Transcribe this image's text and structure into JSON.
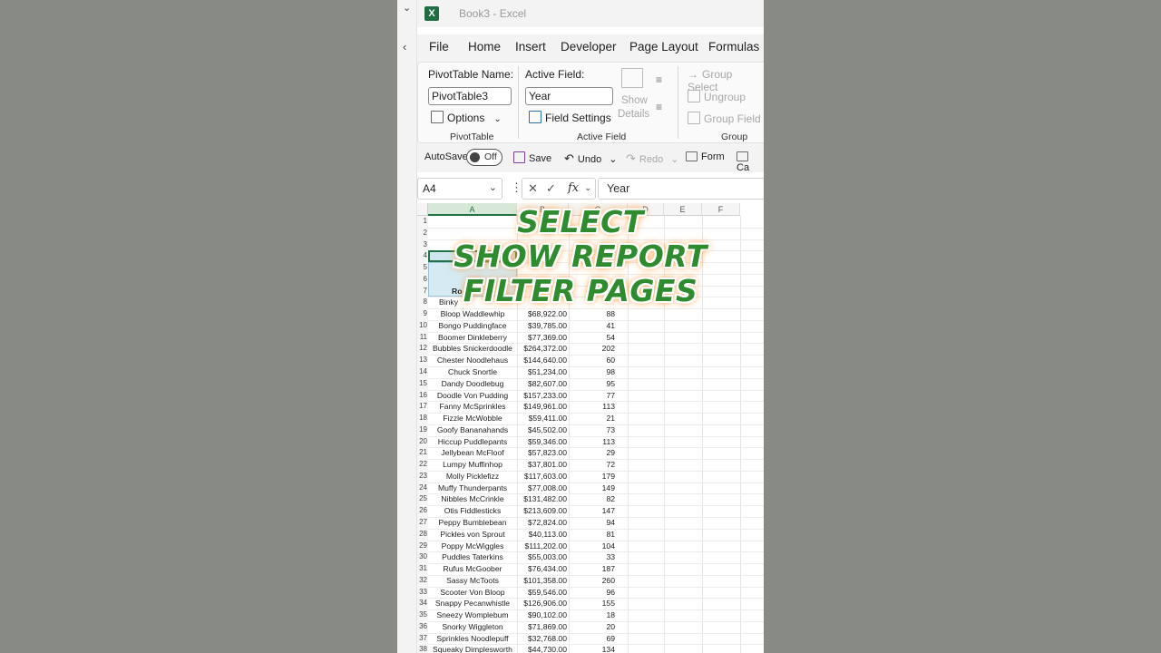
{
  "window": {
    "title": "Book3 - Excel",
    "app_icon": "excel-logo-icon"
  },
  "menu_tabs": [
    "File",
    "Home",
    "Insert",
    "Developer",
    "Page Layout",
    "Formulas"
  ],
  "ribbon": {
    "pivottable": {
      "name_label": "PivotTable Name:",
      "name_value": "PivotTable3",
      "options_label": "Options",
      "group_label": "PivotTable"
    },
    "active_field": {
      "label": "Active Field:",
      "value": "Year",
      "field_settings_label": "Field Settings",
      "show_details_line1": "Show",
      "show_details_line2": "Details",
      "group_label": "Active Field"
    },
    "group": {
      "group_selection_label": "Group Select",
      "ungroup_label": "Ungroup",
      "group_field_label": "Group Field",
      "group_label": "Group"
    }
  },
  "qat": {
    "autosave_label": "AutoSave",
    "autosave_state": "Off",
    "save_label": "Save",
    "undo_label": "Undo",
    "redo_label": "Redo",
    "form_label": "Form",
    "camera_label": "Ca"
  },
  "formula_bar": {
    "name_box": "A4",
    "fx": "fx",
    "value": "Year"
  },
  "columns": [
    "A",
    "B",
    "C",
    "D",
    "E",
    "F"
  ],
  "row_numbers": [
    "1",
    "2",
    "3",
    "4",
    "5",
    "6",
    "7",
    "8",
    "9",
    "10",
    "11",
    "12",
    "13",
    "14",
    "15",
    "16",
    "17",
    "18",
    "19",
    "20",
    "21",
    "22",
    "23",
    "24",
    "25",
    "26",
    "27",
    "28",
    "29",
    "30",
    "31",
    "32",
    "33",
    "34",
    "35",
    "36",
    "37",
    "38"
  ],
  "partial_cells": {
    "row7_a": "Ro",
    "row8_a": "Binky"
  },
  "rows": [
    {
      "name": "Bloop Waddlewhip",
      "money": "$68,922.00",
      "num": "88"
    },
    {
      "name": "Bongo Puddingface",
      "money": "$39,785.00",
      "num": "41"
    },
    {
      "name": "Boomer Dinkleberry",
      "money": "$77,369.00",
      "num": "54"
    },
    {
      "name": "Bubbles Snickerdoodle",
      "money": "$264,372.00",
      "num": "202"
    },
    {
      "name": "Chester Noodlehaus",
      "money": "$144,640.00",
      "num": "60"
    },
    {
      "name": "Chuck Snortle",
      "money": "$51,234.00",
      "num": "98"
    },
    {
      "name": "Dandy Doodlebug",
      "money": "$82,607.00",
      "num": "95"
    },
    {
      "name": "Doodle Von Pudding",
      "money": "$157,233.00",
      "num": "77"
    },
    {
      "name": "Fanny McSprinkles",
      "money": "$149,961.00",
      "num": "113"
    },
    {
      "name": "Fizzle McWobble",
      "money": "$59,411.00",
      "num": "21"
    },
    {
      "name": "Goofy Bananahands",
      "money": "$45,502.00",
      "num": "73"
    },
    {
      "name": "Hiccup Puddlepants",
      "money": "$59,346.00",
      "num": "113"
    },
    {
      "name": "Jellybean McFloof",
      "money": "$57,823.00",
      "num": "29"
    },
    {
      "name": "Lumpy Muffinhop",
      "money": "$37,801.00",
      "num": "72"
    },
    {
      "name": "Molly Picklefizz",
      "money": "$117,603.00",
      "num": "179"
    },
    {
      "name": "Muffy Thunderpants",
      "money": "$77,008.00",
      "num": "149"
    },
    {
      "name": "Nibbles McCrinkle",
      "money": "$131,482.00",
      "num": "82"
    },
    {
      "name": "Otis Fiddlesticks",
      "money": "$213,609.00",
      "num": "147"
    },
    {
      "name": "Peppy Bumblebean",
      "money": "$72,824.00",
      "num": "94"
    },
    {
      "name": "Pickles von Sprout",
      "money": "$40,113.00",
      "num": "81"
    },
    {
      "name": "Poppy McWiggles",
      "money": "$111,202.00",
      "num": "104"
    },
    {
      "name": "Puddles Taterkins",
      "money": "$55,003.00",
      "num": "33"
    },
    {
      "name": "Rufus McGoober",
      "money": "$76,434.00",
      "num": "187"
    },
    {
      "name": "Sassy McToots",
      "money": "$101,358.00",
      "num": "260"
    },
    {
      "name": "Scooter Von Bloop",
      "money": "$59,546.00",
      "num": "96"
    },
    {
      "name": "Snappy Pecanwhistle",
      "money": "$126,906.00",
      "num": "155"
    },
    {
      "name": "Sneezy Womplebum",
      "money": "$90,102.00",
      "num": "18"
    },
    {
      "name": "Snorky Wiggleton",
      "money": "$71,869.00",
      "num": "20"
    },
    {
      "name": "Sprinkles Noodlepuff",
      "money": "$32,768.00",
      "num": "69"
    },
    {
      "name": "Squeaky Dimplesworth",
      "money": "$44,730.00",
      "num": "134"
    }
  ],
  "overlay": {
    "line1": "SELECT",
    "line2": "SHOW REPORT",
    "line3": "FILTER PAGES"
  },
  "colors": {
    "excel_green": "#217346",
    "overlay_text": "#2e8b2e",
    "overlay_glow": "#ff8c2a",
    "pivot_highlight": "#d5eaf2"
  }
}
